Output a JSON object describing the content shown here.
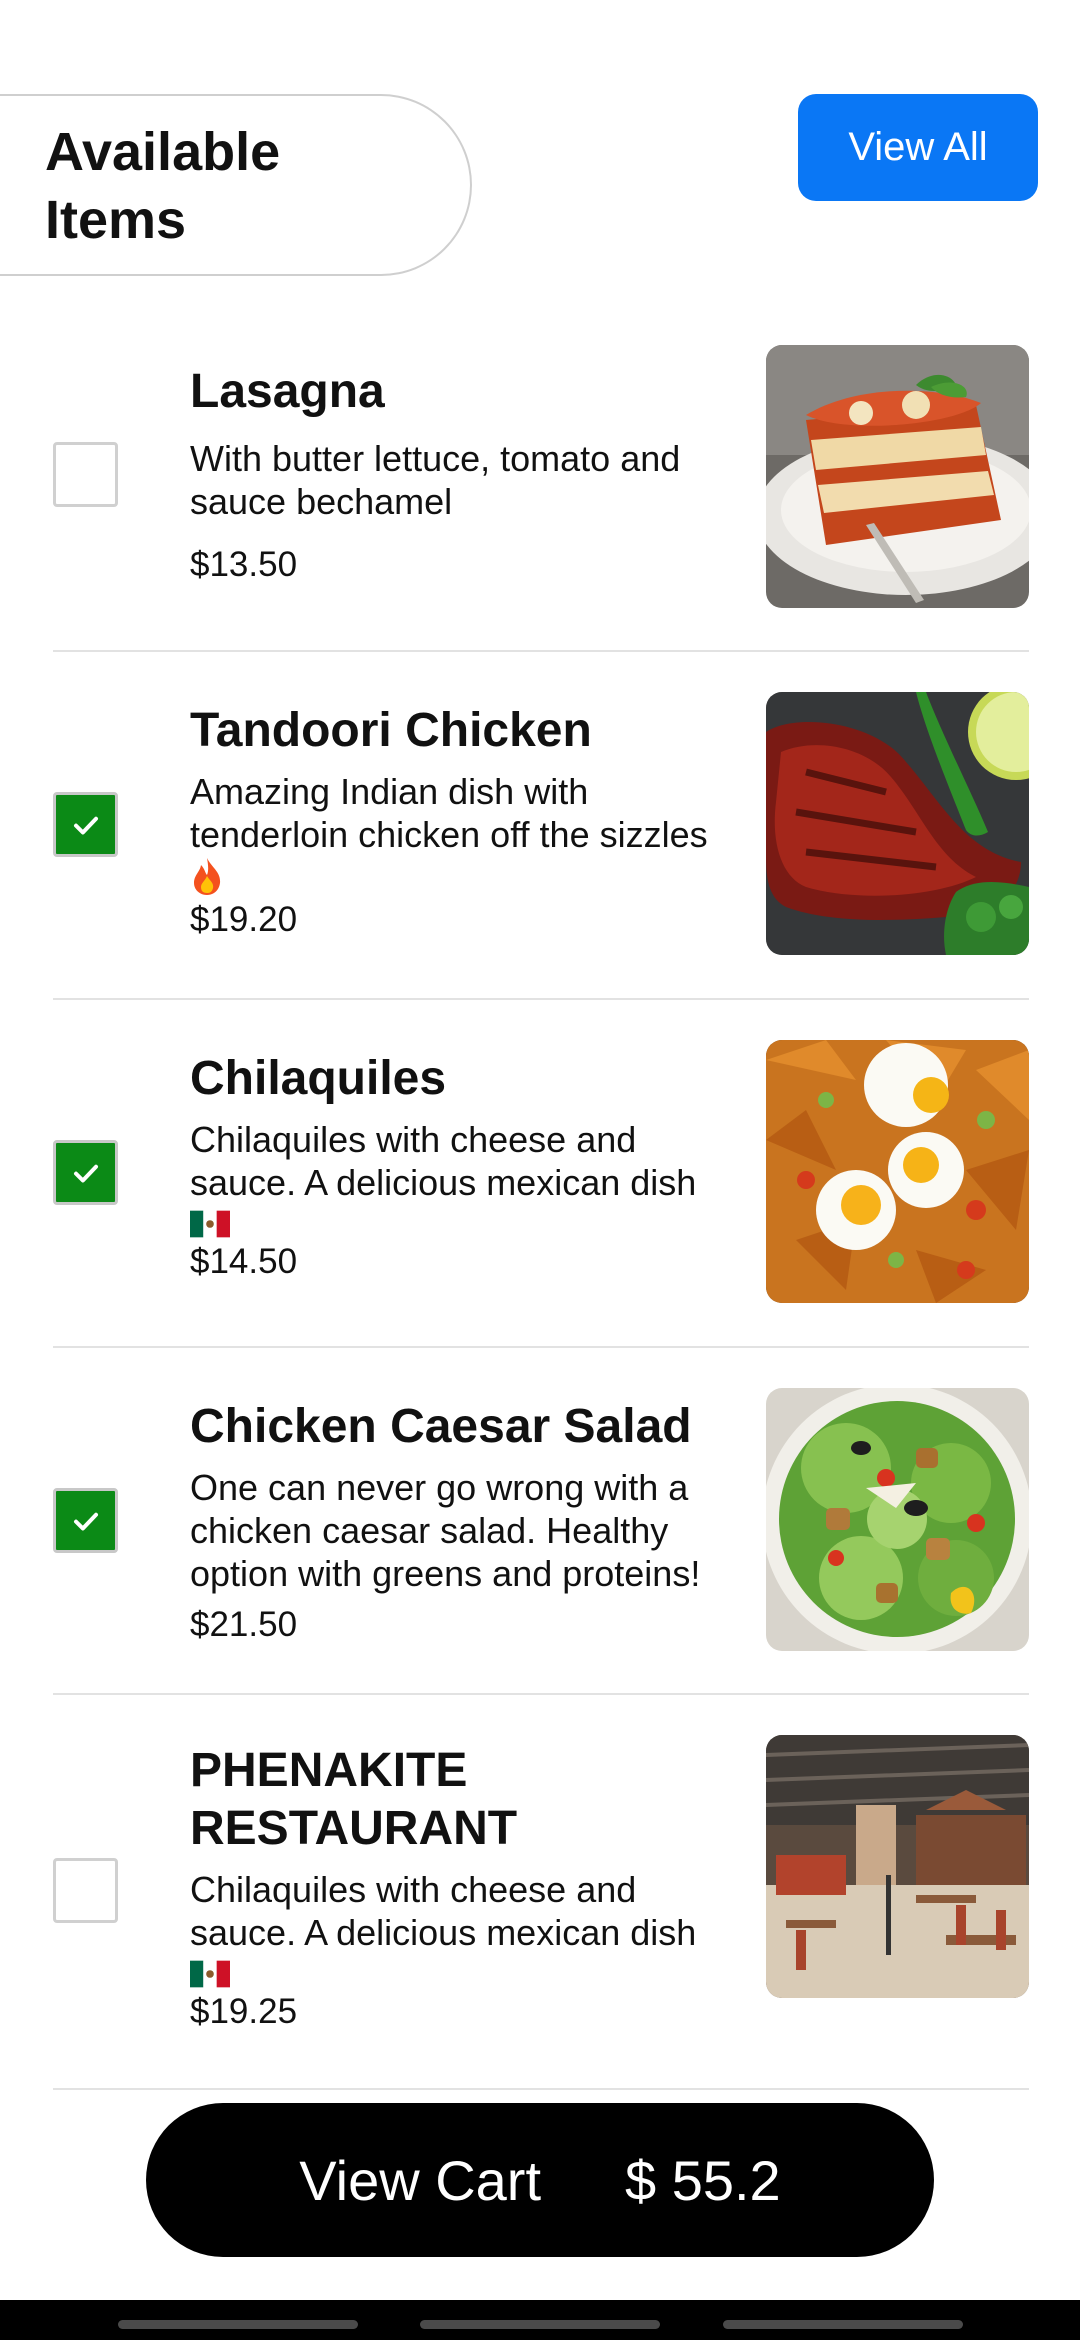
{
  "header": {
    "title": "Available Items",
    "view_all_label": "View All"
  },
  "items": [
    {
      "name": "Lasagna",
      "description": "With butter lettuce, tomato and sauce bechamel",
      "price": "$13.50",
      "checked": false,
      "image": "lasagna-image"
    },
    {
      "name": "Tandoori Chicken",
      "description": "Amazing Indian dish with tenderloin chicken off the sizzles",
      "emoji": "fire-emoji",
      "price": "$19.20",
      "checked": true,
      "image": "tandoori-chicken-image"
    },
    {
      "name": "Chilaquiles",
      "description": "Chilaquiles with cheese and sauce. A delicious mexican dish",
      "emoji": "mexico-flag-emoji",
      "price": "$14.50",
      "checked": true,
      "image": "chilaquiles-image"
    },
    {
      "name": "Chicken Caesar Salad",
      "description": "One can never go wrong with a chicken caesar salad. Healthy option with greens and proteins!",
      "price": "$21.50",
      "checked": true,
      "image": "caesar-salad-image"
    },
    {
      "name": "PHENAKITE RESTAURANT",
      "description": "Chilaquiles with cheese and sauce. A delicious mexican dish",
      "emoji": "mexico-flag-emoji",
      "price": "$19.25",
      "checked": false,
      "image": "restaurant-interior-image"
    }
  ],
  "cart": {
    "label": "View Cart",
    "total": "$ 55.2"
  },
  "colors": {
    "accent_blue": "#0a77f5",
    "check_green": "#0b8a16",
    "cart_bg": "#000000"
  }
}
